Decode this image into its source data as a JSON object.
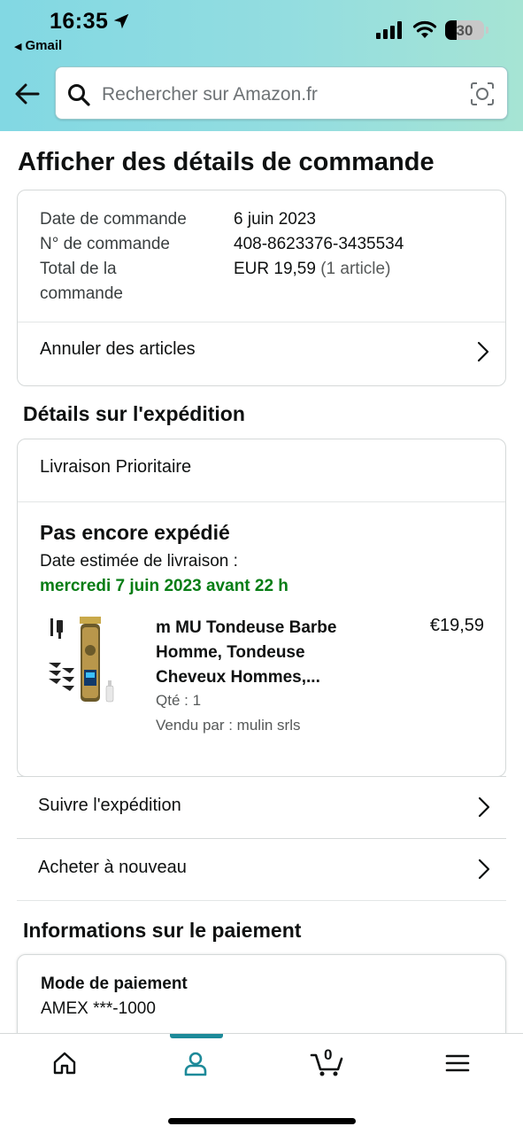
{
  "status_bar": {
    "time": "16:35",
    "back_app": "Gmail",
    "battery": "30"
  },
  "search": {
    "placeholder": "Rechercher sur Amazon.fr"
  },
  "page_title": "Afficher des détails de commande",
  "order_summary": {
    "date_label": "Date de commande",
    "date_value": "6 juin 2023",
    "number_label": "N° de commande",
    "number_value": "408-8623376-3435534",
    "total_label_line1": "Total de la",
    "total_label_line2": "commande",
    "total_value": "EUR 19,59",
    "total_items": "(1 article)",
    "cancel_label": "Annuler des articles"
  },
  "shipping": {
    "section_title": "Détails sur l'expédition",
    "method": "Livraison Prioritaire",
    "status": "Pas encore expédié",
    "eta_label": "Date estimée de livraison :",
    "eta_date": "mercredi 7 juin 2023 avant 22 h",
    "product": {
      "title_line1": "m MU Tondeuse Barbe",
      "title_line2": "Homme, Tondeuse",
      "title_line3": "Cheveux Hommes,...",
      "price": "€19,59",
      "qty": "Qté : 1",
      "seller": "Vendu par : mulin srls"
    }
  },
  "actions": {
    "track": "Suivre l'expédition",
    "buy_again": "Acheter à nouveau"
  },
  "payment": {
    "section_title": "Informations sur le paiement",
    "method_label": "Mode de paiement",
    "method_value": "AMEX ***-1000"
  },
  "tabbar": {
    "cart_count": "0",
    "tabs": [
      "home-icon",
      "account-icon",
      "cart-icon",
      "menu-icon"
    ],
    "active_color": "#1d8a99"
  }
}
